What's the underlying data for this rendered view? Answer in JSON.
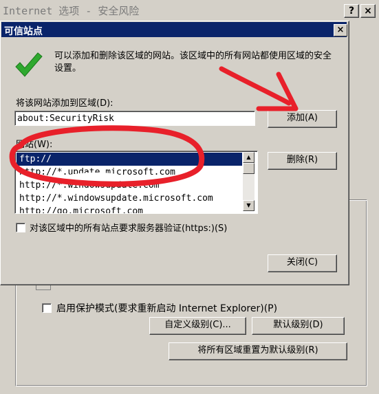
{
  "background_window": {
    "title": "Internet 选项 - 安全风险",
    "help_glyph": "?",
    "close_glyph": "×",
    "protected_mode_label": "启用保护模式(要求重新启动 Internet Explorer)(P)",
    "custom_level_label": "自定义级别(C)...",
    "default_level_label": "默认级别(D)",
    "reset_all_label": "将所有区域重置为默认级别(R)"
  },
  "dialog": {
    "title": "可信站点",
    "close_glyph": "×",
    "info_text": "可以添加和删除该区域的网站。该区域中的所有网站都使用区域的安全设置。",
    "add_label": "将该网站添加到区域(D):",
    "site_input_value": "about:SecurityRisk",
    "add_button": "添加(A)",
    "sites_label": "网站(W):",
    "sites": [
      "ftp://",
      "http://*.update.microsoft.com",
      "http://*.windowsupdate.com",
      "http://*.windowsupdate.microsoft.com",
      "http://go.microsoft.com"
    ],
    "remove_button": "删除(R)",
    "https_label": "对该区域中的所有站点要求服务器验证(https:)(S)",
    "close_button": "关闭(C)"
  },
  "colors": {
    "dialog_titlebar": "#0a246a",
    "annotation": "#e8202a",
    "check_icon": "#2fa82f"
  },
  "icons": {
    "check": "check-icon",
    "scroll_up": "scroll-up-arrow-icon",
    "scroll_down": "scroll-down-arrow-icon"
  }
}
